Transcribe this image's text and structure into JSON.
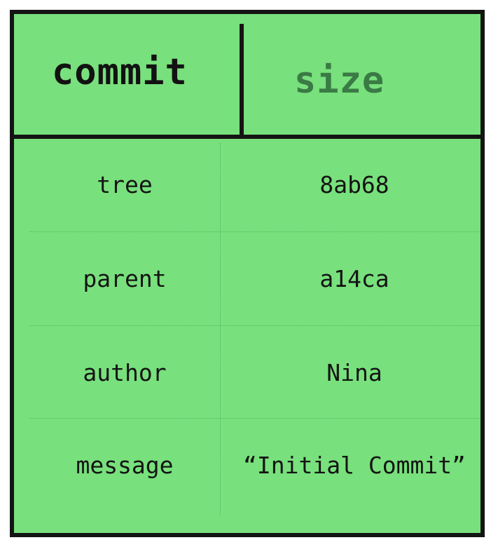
{
  "object": {
    "type": "commit",
    "size_label": "size"
  },
  "fields": [
    {
      "key": "tree",
      "value": "8ab68"
    },
    {
      "key": "parent",
      "value": "a14ca"
    },
    {
      "key": "author",
      "value": "Nina"
    },
    {
      "key": "message",
      "value": "“Initial Commit”"
    }
  ],
  "colors": {
    "background": "#78e07c",
    "border": "#141414",
    "size_text": "#3a7a45"
  }
}
